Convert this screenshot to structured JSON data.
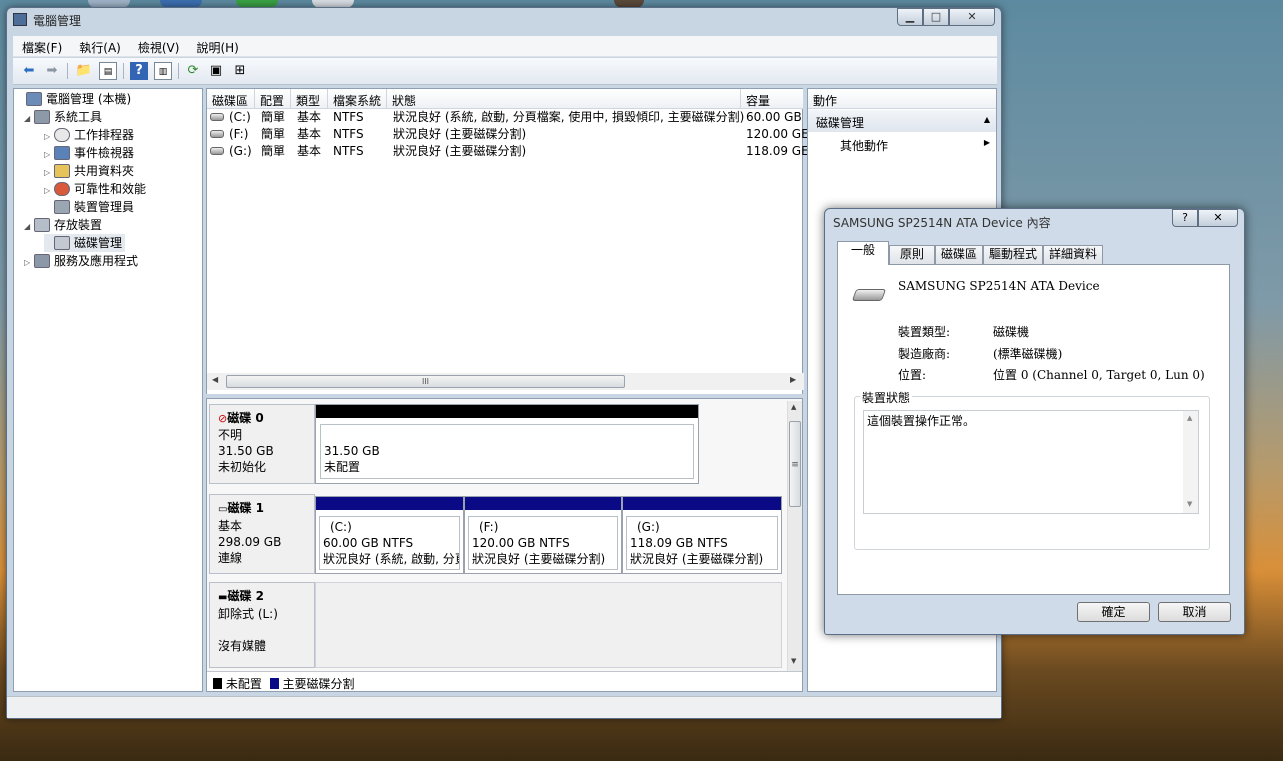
{
  "window": {
    "title": "電腦管理"
  },
  "menu": [
    "檔案(F)",
    "執行(A)",
    "檢視(V)",
    "說明(H)"
  ],
  "tree": [
    {
      "label": "電腦管理 (本機)",
      "level": 0,
      "expander": "",
      "icon": "computer-management-icon"
    },
    {
      "label": "系統工具",
      "level": 1,
      "expander": "◢",
      "icon": "system-tools-icon"
    },
    {
      "label": "工作排程器",
      "level": 2,
      "expander": "▷",
      "icon": "task-scheduler-icon"
    },
    {
      "label": "事件檢視器",
      "level": 2,
      "expander": "▷",
      "icon": "event-viewer-icon"
    },
    {
      "label": "共用資料夾",
      "level": 2,
      "expander": "▷",
      "icon": "shared-folder-icon"
    },
    {
      "label": "可靠性和效能",
      "level": 2,
      "expander": "▷",
      "icon": "performance-icon"
    },
    {
      "label": "裝置管理員",
      "level": 2,
      "expander": "",
      "icon": "device-manager-icon"
    },
    {
      "label": "存放裝置",
      "level": 1,
      "expander": "◢",
      "icon": "storage-icon"
    },
    {
      "label": "磁碟管理",
      "level": 2,
      "expander": "",
      "icon": "disk-management-icon"
    },
    {
      "label": "服務及應用程式",
      "level": 1,
      "expander": "▷",
      "icon": "services-icon"
    }
  ],
  "volumes": {
    "headers": [
      "磁碟區",
      "配置",
      "類型",
      "檔案系統",
      "狀態",
      "容量"
    ],
    "rows": [
      {
        "vol": "(C:)",
        "layout": "簡單",
        "type": "基本",
        "fs": "NTFS",
        "status": "狀況良好 (系統, 啟動, 分頁檔案, 使用中, 損毀傾印, 主要磁碟分割)",
        "capacity": "60.00 GB"
      },
      {
        "vol": "(F:)",
        "layout": "簡單",
        "type": "基本",
        "fs": "NTFS",
        "status": "狀況良好 (主要磁碟分割)",
        "capacity": "120.00 GE"
      },
      {
        "vol": "(G:)",
        "layout": "簡單",
        "type": "基本",
        "fs": "NTFS",
        "status": "狀況良好 (主要磁碟分割)",
        "capacity": "118.09 GE"
      }
    ]
  },
  "hscroll_glyph": "III",
  "vscroll_glyph": "≡",
  "disks": [
    {
      "name": "磁碟 0",
      "kind": "不明",
      "size": "31.50 GB",
      "state": "未初始化",
      "partitions": [
        {
          "title": "",
          "line1": "31.50 GB",
          "line2": "未配置",
          "bar": "#000000"
        }
      ]
    },
    {
      "name": "磁碟 1",
      "kind": "基本",
      "size": "298.09 GB",
      "state": "連線",
      "partitions": [
        {
          "title": "(C:)",
          "line1": "60.00 GB NTFS",
          "line2": "狀況良好 (系統, 啟動, 分頁",
          "bar": "#0a0a86"
        },
        {
          "title": "(F:)",
          "line1": "120.00 GB NTFS",
          "line2": "狀況良好 (主要磁碟分割)",
          "bar": "#0a0a86"
        },
        {
          "title": "(G:)",
          "line1": "118.09 GB NTFS",
          "line2": "狀況良好 (主要磁碟分割)",
          "bar": "#0a0a86"
        }
      ]
    },
    {
      "name": "磁碟 2",
      "kind": "卸除式 (L:)",
      "size": "",
      "state": "沒有媒體",
      "partitions": []
    }
  ],
  "legend": [
    {
      "label": "未配置",
      "color": "#000000"
    },
    {
      "label": "主要磁碟分割",
      "color": "#0a0a86"
    }
  ],
  "actions": {
    "header": "動作",
    "section": "磁碟管理",
    "more": "其他動作"
  },
  "dialog": {
    "title": "SAMSUNG SP2514N ATA Device 內容",
    "tabs": [
      "一般",
      "原則",
      "磁碟區",
      "驅動程式",
      "詳細資料"
    ],
    "device_name": "SAMSUNG SP2514N ATA Device",
    "props": [
      {
        "label": "裝置類型:",
        "value": "磁碟機"
      },
      {
        "label": "製造廠商:",
        "value": "(標準磁碟機)"
      },
      {
        "label": "位置:",
        "value": "位置 0 (Channel 0, Target 0, Lun 0)"
      }
    ],
    "status_group": "裝置狀態",
    "status_text": "這個裝置操作正常。",
    "ok": "確定",
    "cancel": "取消",
    "help": "?",
    "close": "✕"
  }
}
